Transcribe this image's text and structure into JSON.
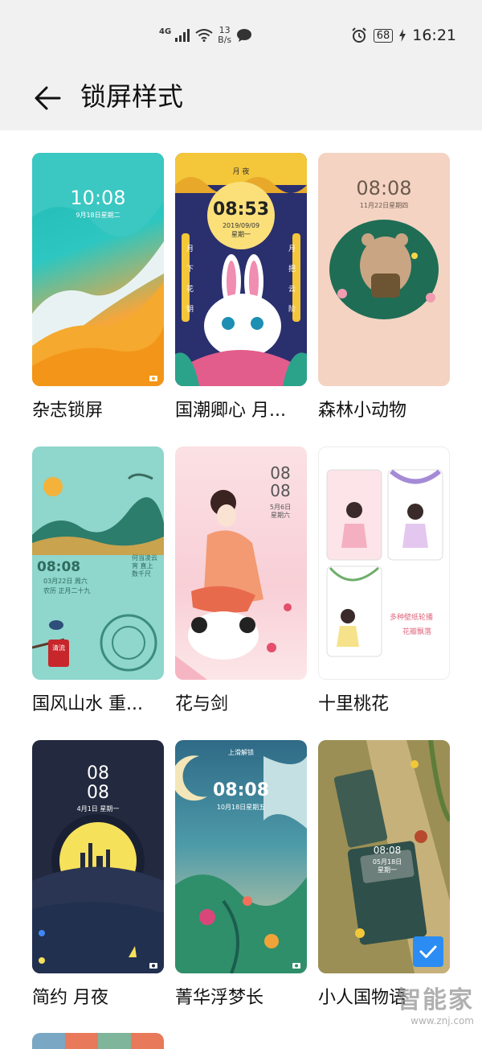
{
  "status_bar": {
    "network": "4G",
    "speed_value": "13",
    "speed_unit": "B/s",
    "battery": "68",
    "time": "16:21",
    "icons": [
      "signal-icon",
      "wifi-icon",
      "message-icon",
      "alarm-icon",
      "charging-icon"
    ]
  },
  "header": {
    "title": "锁屏样式",
    "back_icon": "arrow-left-icon"
  },
  "themes": [
    {
      "label": "杂志锁屏",
      "time": "10:08",
      "date": "9月18日星期二"
    },
    {
      "label": "国潮卿心 月...",
      "time": "08:53",
      "date": "2019/09/09",
      "weekday": "星期一",
      "banner": "月 夜",
      "side_left": [
        "月",
        "下",
        "花",
        "钥"
      ],
      "side_right": [
        "月",
        "把",
        "云",
        "阶"
      ]
    },
    {
      "label": "森林小动物",
      "time": "08:08",
      "date": "11月22日星期四"
    },
    {
      "label": "国风山水 重...",
      "time": "08:08",
      "date": "03月22日 周六",
      "date2": "农历 正月二十九",
      "poem": "何当凌云宵 直上数千尺",
      "seal": "清流"
    },
    {
      "label": "花与剑",
      "time_top": "08",
      "time_bottom": "08",
      "date": "5月6日",
      "weekday": "星期六"
    },
    {
      "label": "十里桃花",
      "caption_1": "多种壁纸轮播",
      "caption_2": "花瓣飘落"
    },
    {
      "label": "简约 月夜",
      "time_top": "08",
      "time_bottom": "08",
      "date": "4月1日 星期一"
    },
    {
      "label": "菁华浮梦长",
      "unlock_text": "上滑解锁",
      "time": "08:08",
      "date": "10月18日星期五"
    },
    {
      "label": "小人国物语",
      "time": "08:08",
      "date": "05月18日",
      "weekday": "星期一",
      "selected": true
    }
  ],
  "watermark": {
    "brand": "智能家",
    "url": "www.znj.com"
  },
  "colors": {
    "accent": "#2b8cf3",
    "header_bg": "#f1f1f1"
  }
}
